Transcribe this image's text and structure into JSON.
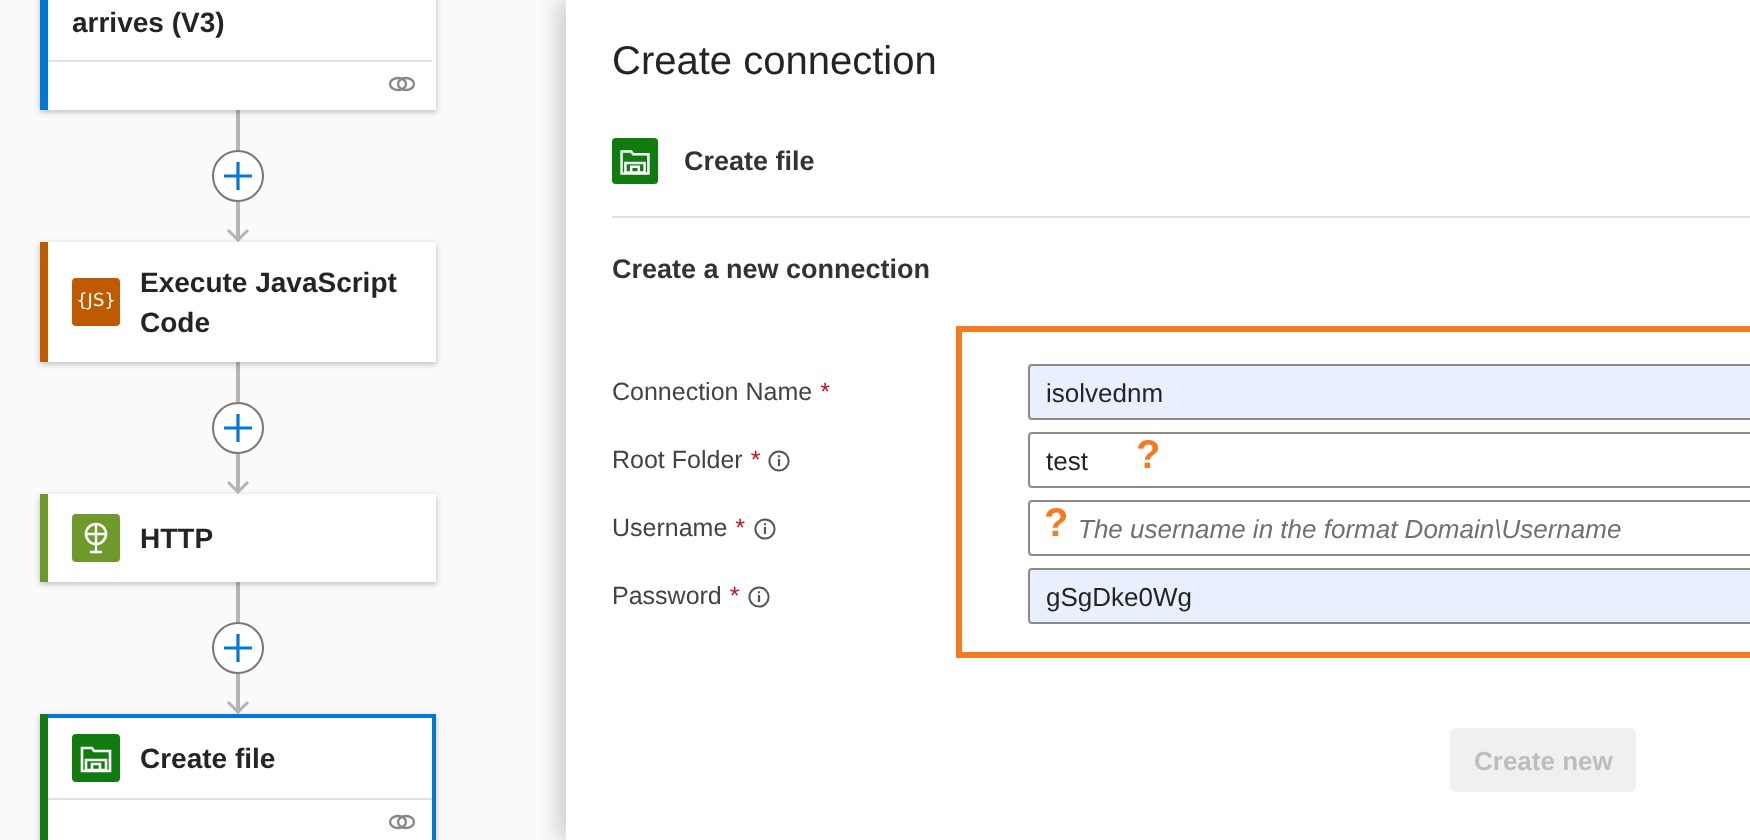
{
  "flow": {
    "cards": [
      {
        "title": "arrives (V3)",
        "kind": "trigger",
        "color": "#0078d4",
        "footer": true,
        "selected": false
      },
      {
        "title": "Execute JavaScript Code",
        "kind": "script",
        "icon_text": "{JS}",
        "color": "#c05a00",
        "footer": false,
        "selected": false
      },
      {
        "title": "HTTP",
        "kind": "web",
        "color": "#6e9a2c",
        "footer": false,
        "selected": false
      },
      {
        "title": "Create file",
        "kind": "file",
        "color": "#107c10",
        "footer": true,
        "selected": true
      }
    ]
  },
  "panel": {
    "title": "Create connection",
    "connector": {
      "name": "Create file",
      "kind": "file"
    },
    "section_title": "Create a new connection",
    "fields": [
      {
        "label": "Connection Name",
        "required_mark": "*",
        "info": false,
        "value": "isolvednm",
        "autofilled": true
      },
      {
        "label": "Root Folder",
        "required_mark": "*",
        "info": true,
        "value": "test",
        "autofilled": false,
        "annotation": "?"
      },
      {
        "label": "Username",
        "required_mark": "*",
        "info": true,
        "placeholder": "The username in the format Domain\\Username",
        "autofilled": false,
        "annotation": "?"
      },
      {
        "label": "Password",
        "required_mark": "*",
        "info": true,
        "value": "gSgDke0Wg",
        "autofilled": true
      }
    ],
    "button": {
      "label": "Create new",
      "disabled": true
    }
  }
}
